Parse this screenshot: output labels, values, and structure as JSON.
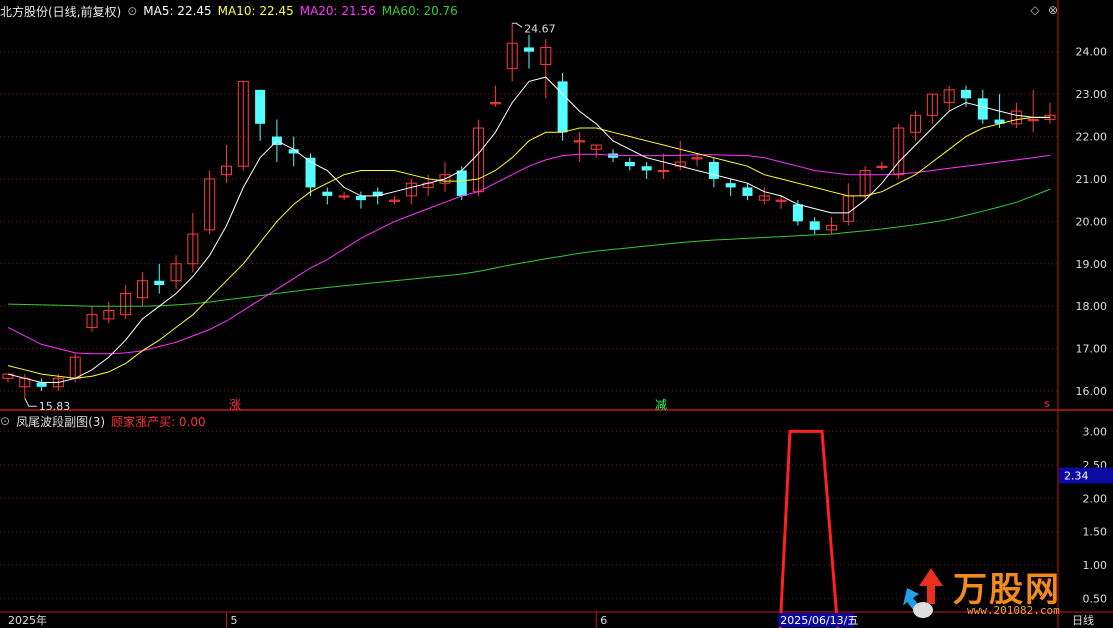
{
  "header": {
    "stock": "北方股份(日线,前复权)",
    "ma5_label": "MA5: 22.45",
    "ma10_label": "MA10: 22.45",
    "ma20_label": "MA20: 21.56",
    "ma60_label": "MA60: 20.76",
    "colors": {
      "ma5": "#ffffff",
      "ma10": "#ffff33",
      "ma20": "#ff33ff",
      "ma60": "#33cc33"
    }
  },
  "sub_header": {
    "name": "凤尾波段副图(3)",
    "indicator": "顾家涨产买: 0.00"
  },
  "markers": {
    "rise": "涨",
    "fall": "减",
    "s": "s"
  },
  "watermark": {
    "text": "万股网",
    "url": "www.201082.com"
  },
  "bottom_labels": {
    "period": "日线"
  },
  "chart_data": {
    "type": "candlestick",
    "main": {
      "ylim": [
        15.6,
        24.7
      ],
      "y_ticks": [
        "16.00",
        "17.00",
        "18.00",
        "19.00",
        "20.00",
        "21.00",
        "22.00",
        "23.00",
        "24.00"
      ],
      "annotations": {
        "high": "24.67",
        "low": "15.83"
      },
      "candles": [
        [
          16.3,
          16.4,
          16.2,
          16.3
        ],
        [
          16.1,
          16.3,
          15.83,
          16.4
        ],
        [
          16.2,
          16.1,
          16.0,
          16.3
        ],
        [
          16.1,
          16.3,
          16.0,
          16.4
        ],
        [
          16.3,
          16.8,
          16.2,
          16.9
        ],
        [
          17.5,
          17.8,
          17.4,
          18.0
        ],
        [
          17.7,
          17.9,
          17.6,
          18.1
        ],
        [
          17.8,
          18.3,
          17.7,
          18.5
        ],
        [
          18.2,
          18.6,
          18.0,
          18.8
        ],
        [
          18.6,
          18.5,
          18.3,
          19.0
        ],
        [
          18.6,
          19.0,
          18.4,
          19.2
        ],
        [
          19.0,
          19.7,
          18.8,
          20.2
        ],
        [
          19.8,
          21.0,
          19.7,
          21.2
        ],
        [
          21.1,
          21.3,
          20.9,
          21.8
        ],
        [
          21.3,
          23.3,
          21.2,
          23.3
        ],
        [
          23.1,
          22.3,
          21.9,
          23.1
        ],
        [
          22.0,
          21.8,
          21.4,
          22.4
        ],
        [
          21.7,
          21.6,
          21.3,
          22.0
        ],
        [
          21.5,
          20.8,
          20.6,
          21.6
        ],
        [
          20.7,
          20.6,
          20.4,
          20.8
        ],
        [
          20.6,
          20.6,
          20.5,
          20.7
        ],
        [
          20.6,
          20.5,
          20.3,
          20.7
        ],
        [
          20.7,
          20.6,
          20.4,
          20.8
        ],
        [
          20.5,
          20.5,
          20.4,
          20.6
        ],
        [
          20.6,
          20.9,
          20.4,
          21.0
        ],
        [
          20.8,
          20.9,
          20.6,
          21.1
        ],
        [
          20.9,
          21.1,
          20.7,
          21.4
        ],
        [
          21.2,
          20.6,
          20.5,
          21.3
        ],
        [
          20.7,
          22.2,
          20.6,
          22.4
        ],
        [
          22.8,
          22.8,
          22.7,
          23.2
        ],
        [
          23.6,
          24.2,
          23.3,
          24.67
        ],
        [
          24.1,
          24.0,
          23.6,
          24.4
        ],
        [
          23.7,
          24.1,
          22.9,
          24.3
        ],
        [
          23.3,
          22.1,
          21.9,
          23.5
        ],
        [
          21.9,
          21.9,
          21.4,
          22.1
        ],
        [
          21.7,
          21.8,
          21.5,
          21.8
        ],
        [
          21.6,
          21.5,
          21.4,
          21.7
        ],
        [
          21.4,
          21.3,
          21.2,
          21.5
        ],
        [
          21.3,
          21.2,
          21.0,
          21.4
        ],
        [
          21.2,
          21.2,
          21.0,
          21.6
        ],
        [
          21.3,
          21.4,
          21.2,
          21.9
        ],
        [
          21.5,
          21.5,
          21.3,
          21.6
        ],
        [
          21.4,
          21.0,
          20.8,
          21.5
        ],
        [
          20.9,
          20.8,
          20.6,
          21.0
        ],
        [
          20.8,
          20.6,
          20.5,
          20.9
        ],
        [
          20.5,
          20.6,
          20.4,
          20.8
        ],
        [
          20.5,
          20.5,
          20.3,
          20.6
        ],
        [
          20.4,
          20.0,
          19.9,
          20.5
        ],
        [
          20.0,
          19.8,
          19.7,
          20.1
        ],
        [
          19.8,
          19.9,
          19.7,
          20.1
        ],
        [
          20.0,
          20.6,
          19.9,
          20.9
        ],
        [
          20.6,
          21.2,
          20.5,
          21.3
        ],
        [
          21.3,
          21.3,
          21.2,
          21.4
        ],
        [
          21.1,
          22.2,
          21.0,
          22.3
        ],
        [
          22.1,
          22.5,
          21.9,
          22.6
        ],
        [
          22.5,
          23.0,
          22.3,
          23.0
        ],
        [
          22.8,
          23.1,
          22.6,
          23.2
        ],
        [
          23.1,
          22.9,
          22.7,
          23.2
        ],
        [
          22.9,
          22.4,
          22.3,
          23.1
        ],
        [
          22.4,
          22.3,
          22.2,
          23.0
        ],
        [
          22.3,
          22.6,
          22.2,
          22.8
        ],
        [
          22.4,
          22.4,
          22.1,
          23.1
        ],
        [
          22.4,
          22.5,
          22.3,
          22.8
        ]
      ],
      "ma5": [
        16.4,
        16.3,
        16.2,
        16.2,
        16.3,
        16.5,
        16.8,
        17.2,
        17.7,
        18.0,
        18.3,
        18.7,
        19.2,
        19.9,
        20.8,
        21.5,
        21.9,
        21.7,
        21.4,
        21.2,
        20.8,
        20.6,
        20.6,
        20.7,
        20.8,
        20.9,
        21.0,
        21.2,
        21.6,
        22.1,
        22.8,
        23.3,
        23.4,
        23.0,
        22.6,
        22.3,
        21.9,
        21.7,
        21.5,
        21.4,
        21.3,
        21.2,
        21.1,
        21.0,
        20.9,
        20.7,
        20.6,
        20.4,
        20.3,
        20.2,
        20.2,
        20.5,
        20.9,
        21.4,
        21.8,
        22.2,
        22.6,
        22.8,
        22.7,
        22.6,
        22.5,
        22.45,
        22.45
      ],
      "ma10": [
        16.6,
        16.5,
        16.4,
        16.35,
        16.3,
        16.35,
        16.45,
        16.65,
        16.95,
        17.2,
        17.5,
        17.8,
        18.2,
        18.6,
        19.0,
        19.5,
        20.0,
        20.4,
        20.7,
        20.9,
        21.1,
        21.2,
        21.2,
        21.2,
        21.1,
        21.0,
        20.95,
        20.95,
        21.0,
        21.2,
        21.5,
        21.9,
        22.1,
        22.1,
        22.2,
        22.2,
        22.1,
        22.0,
        21.9,
        21.8,
        21.7,
        21.6,
        21.5,
        21.4,
        21.3,
        21.1,
        21.0,
        20.9,
        20.8,
        20.7,
        20.6,
        20.6,
        20.7,
        20.9,
        21.1,
        21.4,
        21.7,
        22.0,
        22.2,
        22.3,
        22.4,
        22.45,
        22.45
      ],
      "ma20": [
        17.5,
        17.3,
        17.1,
        17.0,
        16.9,
        16.88,
        16.88,
        16.9,
        16.95,
        17.05,
        17.15,
        17.3,
        17.45,
        17.65,
        17.9,
        18.15,
        18.4,
        18.65,
        18.9,
        19.1,
        19.35,
        19.6,
        19.8,
        20.0,
        20.15,
        20.3,
        20.45,
        20.6,
        20.7,
        20.9,
        21.1,
        21.3,
        21.45,
        21.55,
        21.58,
        21.58,
        21.56,
        21.55,
        21.55,
        21.55,
        21.56,
        21.57,
        21.57,
        21.56,
        21.55,
        21.5,
        21.4,
        21.3,
        21.2,
        21.15,
        21.1,
        21.1,
        21.1,
        21.12,
        21.15,
        21.2,
        21.25,
        21.3,
        21.35,
        21.4,
        21.45,
        21.5,
        21.56
      ],
      "ma60": [
        18.05,
        18.04,
        18.03,
        18.02,
        18.01,
        18.0,
        18.0,
        18.0,
        18.0,
        18.01,
        18.03,
        18.06,
        18.1,
        18.15,
        18.2,
        18.25,
        18.3,
        18.35,
        18.4,
        18.44,
        18.48,
        18.52,
        18.56,
        18.6,
        18.64,
        18.68,
        18.72,
        18.76,
        18.82,
        18.9,
        18.98,
        19.05,
        19.12,
        19.18,
        19.25,
        19.3,
        19.34,
        19.38,
        19.42,
        19.46,
        19.5,
        19.53,
        19.56,
        19.58,
        19.6,
        19.62,
        19.64,
        19.66,
        19.68,
        19.7,
        19.74,
        19.78,
        19.82,
        19.87,
        19.92,
        19.98,
        20.05,
        20.14,
        20.24,
        20.34,
        20.45,
        20.6,
        20.76
      ]
    },
    "sub": {
      "ylim": [
        0.3,
        3.2
      ],
      "y_ticks": [
        "3.00",
        "2.50",
        "2.00",
        "1.50",
        "1.00",
        "0.50"
      ],
      "current_value": "2.34",
      "line": [
        [
          780,
          0.0
        ],
        [
          790,
          3.0
        ],
        [
          822,
          3.0
        ],
        [
          838,
          0.0
        ]
      ]
    },
    "x_labels": [
      {
        "text": "2025年",
        "at": 0
      },
      {
        "text": "5",
        "at": 13
      },
      {
        "text": "6",
        "at": 35
      },
      {
        "text": "2025/06/13/五",
        "at": 45
      }
    ]
  }
}
